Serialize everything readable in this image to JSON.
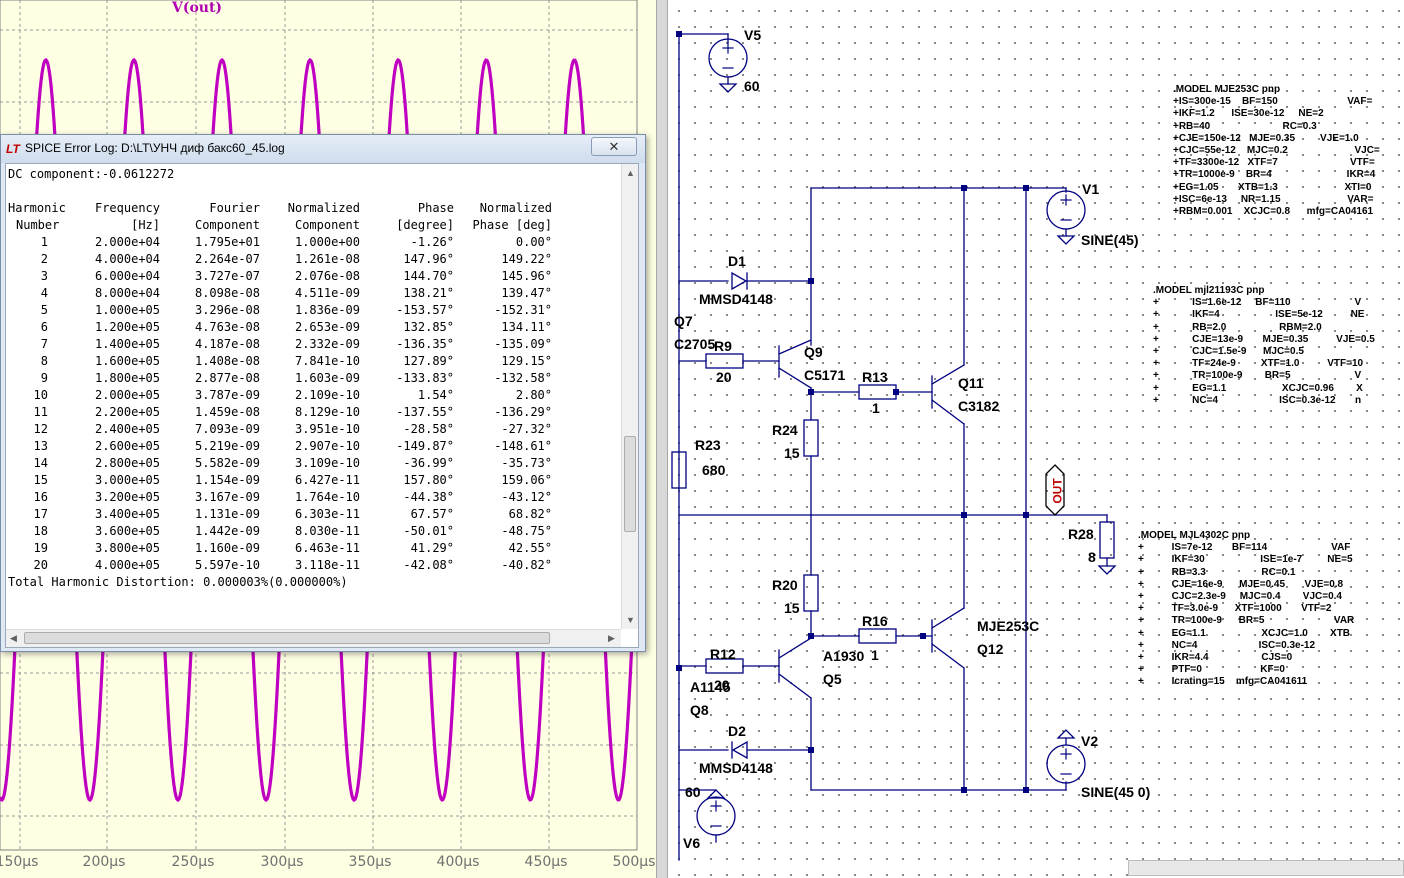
{
  "waveform": {
    "trace_name": "V(out)",
    "trace_color": "#c000c0",
    "background": "#ffffe4",
    "x_ticks": [
      "150µs",
      "200µs",
      "250µs",
      "300µs",
      "350µs",
      "400µs",
      "450µs",
      "500µs"
    ]
  },
  "log_window": {
    "title": "SPICE Error Log: D:\\LT\\УНЧ диф бакс60_45.log",
    "close_glyph": "✕",
    "dc_line": "DC component:-0.0612272",
    "headers_line1": [
      "Harmonic",
      "Frequency",
      "Fourier",
      "Normalized",
      "Phase",
      "Normalized"
    ],
    "headers_line2": [
      "Number",
      "[Hz]",
      "Component",
      "Component",
      "[degree]",
      "Phase [deg]"
    ],
    "rows": [
      [
        "1",
        "2.000e+04",
        "1.795e+01",
        "1.000e+00",
        "-1.26°",
        "0.00°"
      ],
      [
        "2",
        "4.000e+04",
        "2.264e-07",
        "1.261e-08",
        "147.96°",
        "149.22°"
      ],
      [
        "3",
        "6.000e+04",
        "3.727e-07",
        "2.076e-08",
        "144.70°",
        "145.96°"
      ],
      [
        "4",
        "8.000e+04",
        "8.098e-08",
        "4.511e-09",
        "138.21°",
        "139.47°"
      ],
      [
        "5",
        "1.000e+05",
        "3.296e-08",
        "1.836e-09",
        "-153.57°",
        "-152.31°"
      ],
      [
        "6",
        "1.200e+05",
        "4.763e-08",
        "2.653e-09",
        "132.85°",
        "134.11°"
      ],
      [
        "7",
        "1.400e+05",
        "4.187e-08",
        "2.332e-09",
        "-136.35°",
        "-135.09°"
      ],
      [
        "8",
        "1.600e+05",
        "1.408e-08",
        "7.841e-10",
        "127.89°",
        "129.15°"
      ],
      [
        "9",
        "1.800e+05",
        "2.877e-08",
        "1.603e-09",
        "-133.83°",
        "-132.58°"
      ],
      [
        "10",
        "2.000e+05",
        "3.787e-09",
        "2.109e-10",
        "1.54°",
        "2.80°"
      ],
      [
        "11",
        "2.200e+05",
        "1.459e-08",
        "8.129e-10",
        "-137.55°",
        "-136.29°"
      ],
      [
        "12",
        "2.400e+05",
        "7.093e-09",
        "3.951e-10",
        "-28.58°",
        "-27.32°"
      ],
      [
        "13",
        "2.600e+05",
        "5.219e-09",
        "2.907e-10",
        "-149.87°",
        "-148.61°"
      ],
      [
        "14",
        "2.800e+05",
        "5.582e-09",
        "3.109e-10",
        "-36.99°",
        "-35.73°"
      ],
      [
        "15",
        "3.000e+05",
        "1.154e-09",
        "6.427e-11",
        "157.80°",
        "159.06°"
      ],
      [
        "16",
        "3.200e+05",
        "3.167e-09",
        "1.764e-10",
        "-44.38°",
        "-43.12°"
      ],
      [
        "17",
        "3.400e+05",
        "1.131e-09",
        "6.303e-11",
        "67.57°",
        "68.82°"
      ],
      [
        "18",
        "3.600e+05",
        "1.442e-09",
        "8.030e-11",
        "-50.01°",
        "-48.75°"
      ],
      [
        "19",
        "3.800e+05",
        "1.160e-09",
        "6.463e-11",
        "41.29°",
        "42.55°"
      ],
      [
        "20",
        "4.000e+05",
        "5.597e-10",
        "3.118e-11",
        "-42.08°",
        "-40.82°"
      ]
    ],
    "thd_line": "Total Harmonic Distortion: 0.000003%(0.000000%)"
  },
  "schematic": {
    "labels": {
      "V5": "V5",
      "V5_val": "60",
      "V1": "V1",
      "V1_val": "SINE(45)",
      "D1": "D1",
      "D1_part": "MMSD4148",
      "Q7": "Q7",
      "Q7_part": "C2705",
      "R9": "R9",
      "R9_val": "20",
      "Q9": "Q9",
      "Q9_part": "C5171",
      "R13": "R13",
      "R13_val": "1",
      "Q11": "Q11",
      "Q11_part": "C3182",
      "R24": "R24",
      "R24_val": "15",
      "R23": "R23",
      "R23_val": "680",
      "OUT": "OUT",
      "R28": "R28",
      "R28_val": "8",
      "R20": "R20",
      "R20_val": "15",
      "R16": "R16",
      "R16_val": "1",
      "Q12_part": "MJE253C",
      "Q12": "Q12",
      "R12": "R12",
      "R12_val": "20",
      "Q5_part": "A1930",
      "Q5": "Q5",
      "Q8_part": "A1145",
      "Q8": "Q8",
      "D2": "D2",
      "D2_part": "MMSD4148",
      "V2": "V2",
      "V2_val": "SINE(45 0)",
      "V6_val": "60",
      "V6": "V6"
    },
    "model1": ".MODEL MJE253C pnp\n+IS=300e-15    BF=150                         VAF=\n+IKF=1.2      ISE=30e-12     NE=2\n+RB=40                          RC=0.3\n+CJE=150e-12   MJE=0.35         VJE=1.0\n+CJC=55e-12    MJC=0.2                        VJC=\n+TF=3300e-12   XTF=7                          VTF=\n+TR=1000e-9    BR=4                           IKR=4\n+EG=1.05       XTB=1.3                        XTI=0\n+ISC=6e-13     NR=1.15                        VAR=\n+RBM=0.001    XCJC=0.8      mfg=CA04161",
    "model2": ".MODEL mjl21193C pnp\n+            IS=1.6e-12     BF=110                       V\n+            IKF=4                    ISE=5e-12          NE\n+            RB=2.0                   RBM=2.0\n+            CJE=13e-9       MJE=0.35          VJE=0.5\n+            CJC=1.5e-9      MJC=0.5\n+            TF=24e-9         XTF=1.0          VTF=10\n+            TR=100e-9        BR=5                       V\n+            EG=1.1                    XCJC=0.96        X\n+            NC=4                      ISC=0.3e-12       n",
    "model3": ".MODEL MJL4302C pnp\n+          IS=7e-12       BF=114                       VAF\n+          IKF=30                    ISE=1e-7         NE=5\n+          RB=3.3                    RC=0.1\n+          CJE=16e-9      MJE=0.45       VJE=0.8\n+          CJC=2.3e-9     MJC=0.4        VJC=0.4\n+          TF=3.0e-9      XTF=1000       VTF=2\n+          TR=100e-9      BR=5                         VAR\n+          EG=1.1                    XCJC=1.0        XTB\n+          NC=4                      ISC=0.3e-12\n+          IKR=4.4                   CJS=0\n+          PTF=0                     KF=0\n+          Icrating=15    mfg=CA041611"
  }
}
